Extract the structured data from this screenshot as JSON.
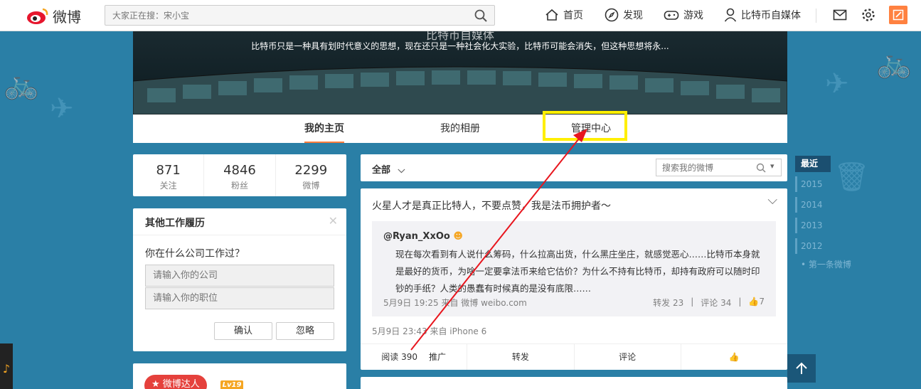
{
  "topnav": {
    "logo_text": "微博",
    "search_placeholder": "大家正在搜：宋小宝",
    "items": [
      "首页",
      "发现",
      "游戏",
      "比特币自媒体"
    ]
  },
  "banner": {
    "title": "比特币自媒体",
    "description": "比特币只是一种具有划时代意义的思想，现在还只是一种社会化大实验，比特币可能会消失，但这种思想将永..."
  },
  "tabs": [
    "我的主页",
    "我的相册",
    "管理中心"
  ],
  "stats": [
    {
      "num": "871",
      "label": "关注"
    },
    {
      "num": "4846",
      "label": "粉丝"
    },
    {
      "num": "2299",
      "label": "微博"
    }
  ],
  "work": {
    "title": "其他工作履历",
    "question": "你在什么公司工作过？",
    "company_placeholder": "请输入你的公司",
    "position_placeholder": "请输入你的职位",
    "confirm": "确认",
    "ignore": "忽略"
  },
  "badges": {
    "talent": "微博达人",
    "level": "Lv19"
  },
  "feed": {
    "filter": "全部",
    "search_placeholder": "搜索我的微博",
    "post": {
      "text": "火星人才是真正比特人，不要点赞，我是法币拥护者～",
      "repost_author": "@Ryan_XxOo",
      "repost_body": "现在每次看到有人说什么筹码，什么拉高出货，什么黑庄坐庄，就感觉恶心……比特币本身就是最好的货币，为啥一定要拿法币来给它估价？为什么不持有比特币，却持有政府可以随时印钞的手纸？人类的愚蠢有时候真的是没有底限……",
      "repost_meta": "5月9日 19:25 来自 微博 weibo.com",
      "repost_forward": "转发 23",
      "repost_comment": "评论 34",
      "repost_like": "7",
      "meta": "5月9日 23:43 来自 iPhone 6",
      "actions": [
        "阅读 390",
        "推广",
        "转发",
        "评论"
      ]
    }
  },
  "timeline": {
    "recent": "最近",
    "years": [
      "2015",
      "2014",
      "2013",
      "2012"
    ],
    "first": "第一条微博"
  }
}
